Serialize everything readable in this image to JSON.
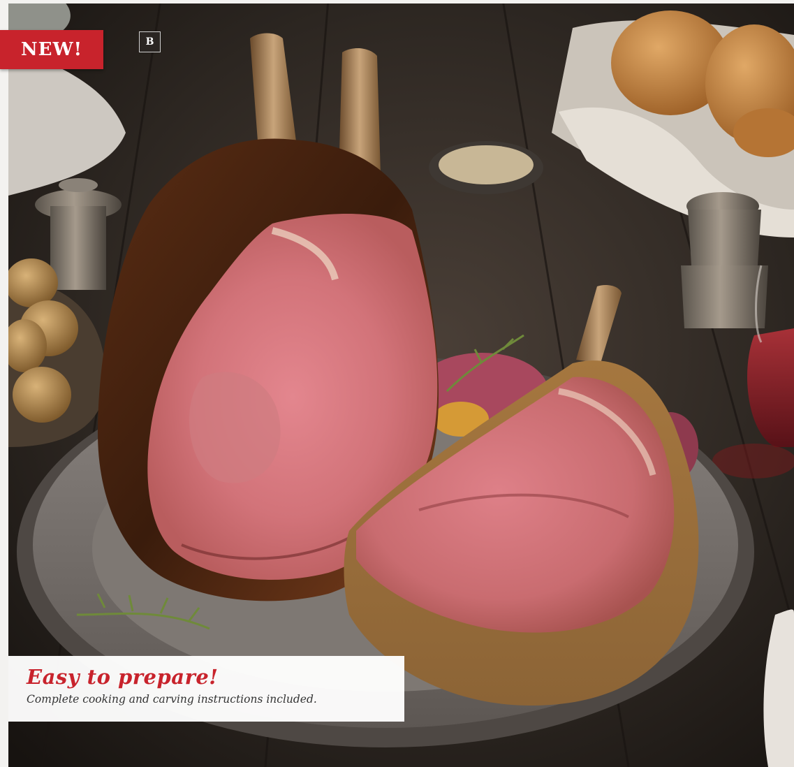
{
  "badge_new": "NEW!",
  "badge_letter": "B",
  "caption": {
    "title": "Easy to prepare!",
    "subtitle": "Complete cooking and carving instructions included."
  },
  "colors": {
    "accent_red": "#c8232c",
    "caption_bg": "#ffffff",
    "caption_text": "#333333"
  }
}
